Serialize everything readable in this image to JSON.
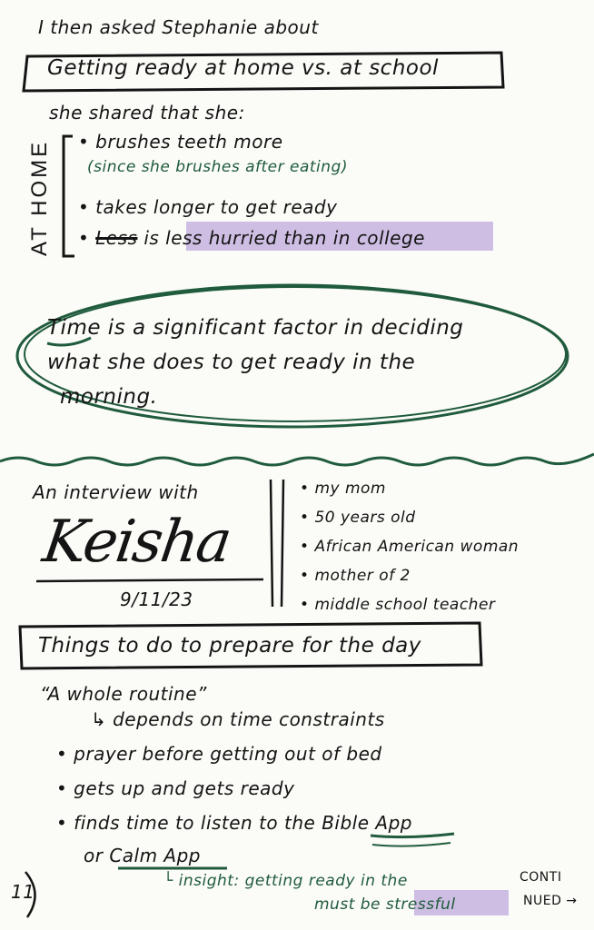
{
  "intro": "I then asked Stephanie about",
  "topic1_box": "Getting ready at home vs. at school",
  "she_shared": "she shared that she:",
  "at_home_label": "AT HOME",
  "at_home_items": [
    "brushes teeth more",
    "takes longer to get ready",
    "is less hurried than in college"
  ],
  "struck_word": "Less",
  "brush_note": "(since she brushes after eating)",
  "insight1": [
    "Time is a significant factor in deciding",
    "what she does to get ready in the",
    "morning."
  ],
  "interview_heading": "An interview with",
  "interviewee_name": "Keisha",
  "interview_date": "9/11/23",
  "profile": [
    "my mom",
    "50 years old",
    "African American woman",
    "mother of 2",
    "middle school teacher"
  ],
  "topic2_box": "Things to do to prepare for the day",
  "quote": "“A whole routine”",
  "quote_sub": "↳ depends on time constraints",
  "routine": [
    "prayer before getting out of bed",
    "gets up and gets ready",
    "finds time to listen to the Bible App",
    "or Calm App"
  ],
  "insight2": [
    "└ insight: getting ready in the",
    "must be stressful"
  ],
  "page_number": "11",
  "continued": [
    "CONTI",
    "NUED →"
  ],
  "colors": {
    "ink": "#141414",
    "green_ink": "#1f5b3c",
    "highlight": "#b49ad8"
  }
}
